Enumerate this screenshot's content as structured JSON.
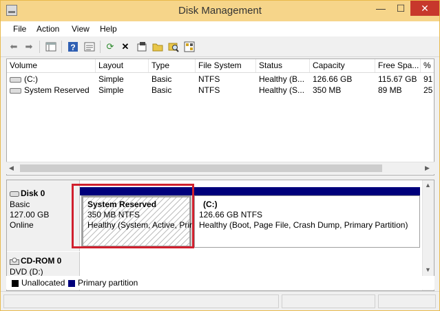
{
  "window": {
    "title": "Disk Management",
    "controls": {
      "minimize": "—",
      "maximize": "☐",
      "close": "✕"
    }
  },
  "menu": [
    "File",
    "Action",
    "View",
    "Help"
  ],
  "toolbar": {
    "icons": [
      "back-arrow-icon",
      "forward-arrow-icon",
      "console-view-icon",
      "help-icon",
      "properties-list-icon",
      "refresh-icon",
      "delete-icon",
      "properties-icon",
      "open-folder-icon",
      "explore-icon",
      "settings-icon"
    ]
  },
  "volume_list": {
    "columns": [
      "Volume",
      "Layout",
      "Type",
      "File System",
      "Status",
      "Capacity",
      "Free Spa...",
      "% F"
    ],
    "rows": [
      {
        "volume": "(C:)",
        "layout": "Simple",
        "type": "Basic",
        "fs": "NTFS",
        "status": "Healthy (B...",
        "capacity": "126.66 GB",
        "free": "115.67 GB",
        "pct": "91"
      },
      {
        "volume": "System Reserved",
        "layout": "Simple",
        "type": "Basic",
        "fs": "NTFS",
        "status": "Healthy (S...",
        "capacity": "350 MB",
        "free": "89 MB",
        "pct": "25"
      }
    ]
  },
  "disks": [
    {
      "name": "Disk 0",
      "type": "Basic",
      "size": "127.00 GB",
      "state": "Online",
      "partitions": [
        {
          "name": "System Reserved",
          "size_fs": "350 MB NTFS",
          "status": "Healthy (System, Active, Prir"
        },
        {
          "name": "(C:)",
          "size_fs": "126.66 GB NTFS",
          "status": "Healthy (Boot, Page File, Crash Dump, Primary Partition)"
        }
      ]
    },
    {
      "name": "CD-ROM 0",
      "type": "DVD (D:)"
    }
  ],
  "legend": {
    "unallocated": "Unallocated",
    "primary": "Primary partition",
    "colors": {
      "unallocated": "#000000",
      "primary": "#00007b"
    }
  },
  "colors": {
    "title_bar": "#f6d58a",
    "highlight_box": "#d0202e"
  }
}
